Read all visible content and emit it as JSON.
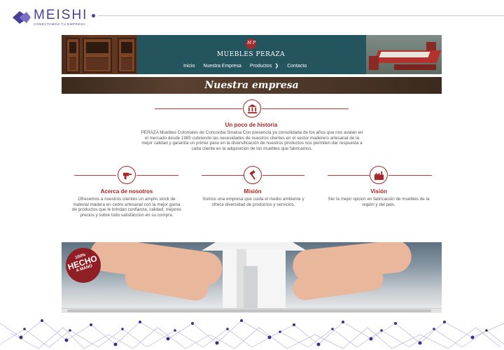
{
  "brand": {
    "name": "MEISHI",
    "tagline": "CONECTAMOS TU EMPRESA",
    "accent": "#4a3f98"
  },
  "site": {
    "logo_text": "M P",
    "title": "MUEBLES PERAZA",
    "nav": [
      {
        "label": "Inicio"
      },
      {
        "label": "Nuestra Empresa"
      },
      {
        "label": "Productos",
        "has_submenu": true
      },
      {
        "label": "Contacto"
      }
    ],
    "banner_title": "Nuestra empresa",
    "history": {
      "heading": "Un poco de historia",
      "text": "PERAZA Muebles Coloniales de Concordia Sinaloa Con presencia ya consolidada de los años que nos avalan en el mercado desde 1985 cubriendo las necesidades de nuestros clientes en el sector maderero artesanal de la mejor calidad y garantía un primer paso en la diversificación de nuestros productos nos permiten dar respuesta a cada cliente en la adquisición de los muebles que fabricamos."
    },
    "columns": [
      {
        "heading": "Acerca de nosotros",
        "icon": "drill-icon",
        "text": "Ofrecemos a nuestros clientes un amplio stock de material madera en cedro artesanal con la mejor gama de productos que le brindan confianza, calidad, mejores precios y sobre todo satisfaccion en su compra."
      },
      {
        "heading": "Misión",
        "icon": "hammer-icon",
        "text": "Somos una empresa que cuida el medio ambiente y ofrece diversidad de productos y servicios."
      },
      {
        "heading": "Visión",
        "icon": "factory-icon",
        "text": "Ser la mejor opcion en fabricación de muebles de la región y del pais."
      }
    ],
    "stamp": {
      "line1": "100%",
      "line2": "HECHO",
      "line3": "A MANO"
    },
    "accent": "#a7262a"
  }
}
